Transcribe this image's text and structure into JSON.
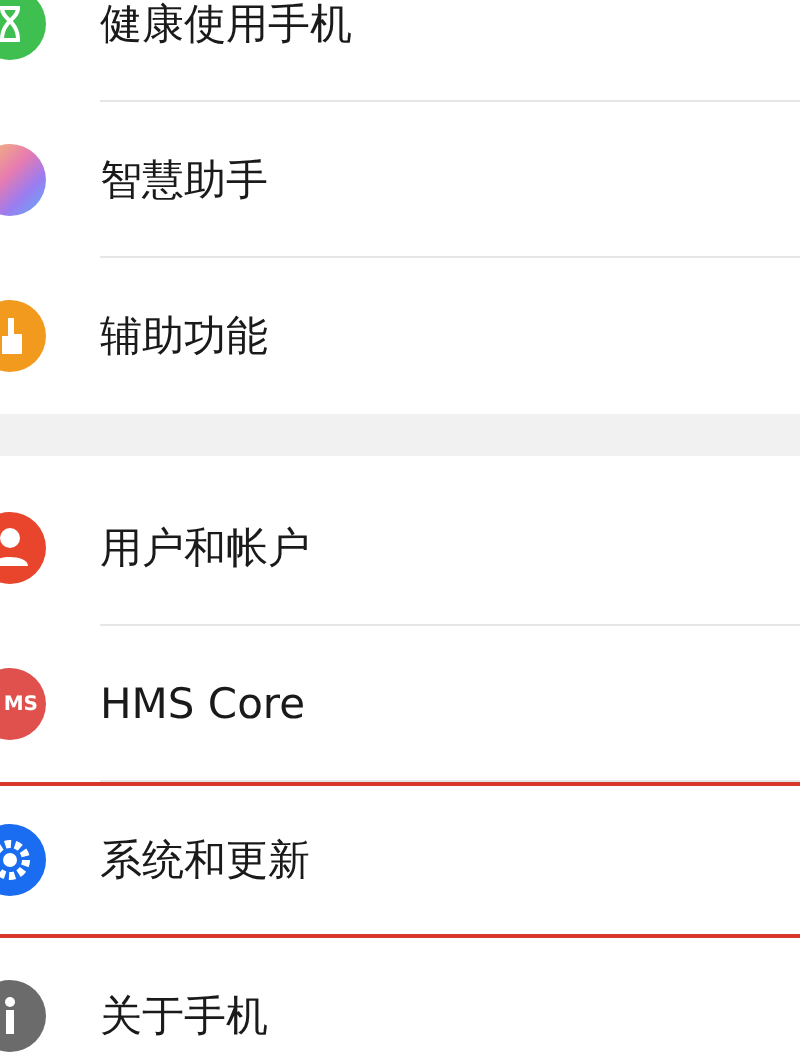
{
  "groups": [
    {
      "items": [
        {
          "label": "健康使用手机",
          "highlighted": false
        },
        {
          "label": "智慧助手",
          "highlighted": false
        },
        {
          "label": "辅助功能",
          "highlighted": false
        }
      ]
    },
    {
      "items": [
        {
          "label": "用户和帐户",
          "highlighted": false
        },
        {
          "label": "HMS Core",
          "icon_text": "MS",
          "highlighted": false
        },
        {
          "label": "系统和更新",
          "highlighted": true
        },
        {
          "label": "关于手机",
          "highlighted": false
        }
      ]
    }
  ]
}
